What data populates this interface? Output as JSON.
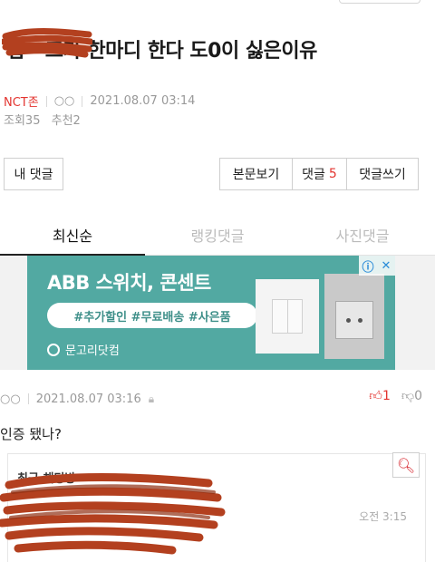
{
  "post": {
    "title": "잡**즈가 한마디 한다 도0이 싫은이유",
    "board": "NCT존",
    "author": "○○",
    "datetime": "2021.08.07 03:14",
    "views_label": "조회",
    "views": "35",
    "recommend_label": "추천",
    "recommend": "2"
  },
  "buttons": {
    "my_comments": "내 댓글",
    "view_post": "본문보기",
    "comments": "댓글",
    "comment_count": "5",
    "write_comment": "댓글쓰기"
  },
  "tabs": [
    {
      "label": "최신순",
      "active": true
    },
    {
      "label": "랭킹댓글",
      "active": false
    },
    {
      "label": "사진댓글",
      "active": false
    }
  ],
  "ad": {
    "title": "ABB 스위치, 콘센트",
    "tags": "#추가할인 #무료배송 #사은품",
    "brand": "문고리닷컴",
    "info_icon": "info-icon",
    "close_icon": "close-icon",
    "bg_color": "#52a9a2"
  },
  "comment": {
    "author": "○○",
    "datetime": "2021.08.07 03:16",
    "likes": "1",
    "dislikes": "0",
    "text": "인증 됐나?"
  },
  "recent": {
    "title": "최근 채팅방",
    "time": "오전 3:15"
  },
  "colors": {
    "accent": "#e3342f",
    "redaction": "#b3401f"
  }
}
